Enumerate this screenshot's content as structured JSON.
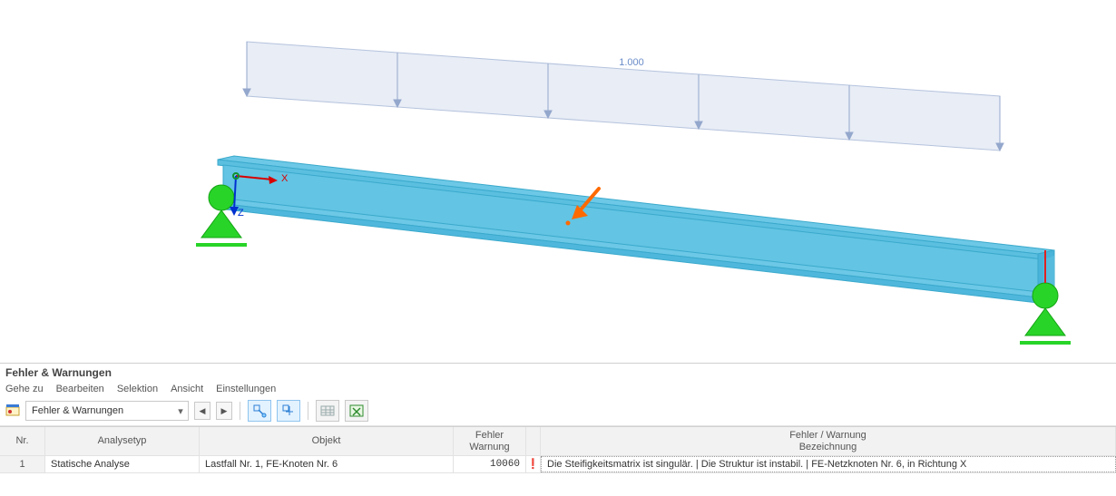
{
  "load_label": "1.000",
  "axis_x": "X",
  "axis_z": "Z",
  "panel_title": "Fehler & Warnungen",
  "menu": {
    "goto": "Gehe zu",
    "edit": "Bearbeiten",
    "select": "Selektion",
    "view": "Ansicht",
    "settings": "Einstellungen"
  },
  "combo_label": "Fehler & Warnungen",
  "headers": {
    "nr": "Nr.",
    "analyse": "Analysetyp",
    "objekt": "Objekt",
    "fw1": "Fehler",
    "fw2": "Warnung",
    "bz1": "Fehler / Warnung",
    "bz2": "Bezeichnung"
  },
  "row": {
    "nr": "1",
    "analyse": "Statische Analyse",
    "objekt": "Lastfall Nr. 1, FE-Knoten Nr. 6",
    "code": "10060",
    "msg": "Die Steifigkeitsmatrix ist singulär. |  Die Struktur ist instabil. | FE-Netzknoten Nr. 6, in Richtung X"
  }
}
